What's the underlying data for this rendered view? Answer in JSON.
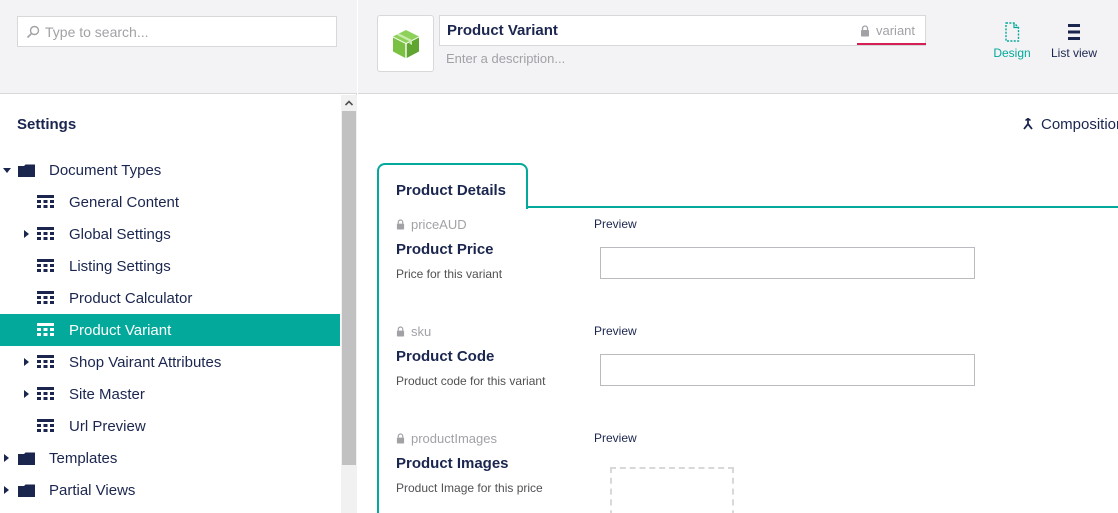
{
  "search": {
    "placeholder": "Type to search..."
  },
  "tree": {
    "title": "Settings",
    "items": [
      {
        "label": "Document Types",
        "kind": "folder",
        "caret": "down"
      },
      {
        "label": "General Content",
        "kind": "doctype",
        "caret": ""
      },
      {
        "label": "Global Settings",
        "kind": "doctype",
        "caret": "right"
      },
      {
        "label": "Listing Settings",
        "kind": "doctype",
        "caret": ""
      },
      {
        "label": "Product Calculator",
        "kind": "doctype",
        "caret": ""
      },
      {
        "label": "Product Variant",
        "kind": "doctype",
        "caret": "",
        "selected": true
      },
      {
        "label": "Shop Vairant Attributes",
        "kind": "doctype",
        "caret": "right"
      },
      {
        "label": "Site Master",
        "kind": "doctype",
        "caret": "right"
      },
      {
        "label": "Url Preview",
        "kind": "doctype",
        "caret": ""
      },
      {
        "label": "Templates",
        "kind": "folder",
        "caret": "right"
      },
      {
        "label": "Partial Views",
        "kind": "folder",
        "caret": "right"
      }
    ]
  },
  "header": {
    "name": "Product Variant",
    "alias": "variant",
    "description_placeholder": "Enter a description...",
    "icon": "box-icon",
    "design_label": "Design",
    "listview_label": "List view"
  },
  "main": {
    "compositions_label": "Compositions",
    "group": {
      "title": "Product Details",
      "properties": [
        {
          "alias": "priceAUD",
          "name": "Product Price",
          "description": "Price for this variant",
          "preview_label": "Preview",
          "editor": "textbox"
        },
        {
          "alias": "sku",
          "name": "Product Code",
          "description": "Product code for this variant",
          "preview_label": "Preview",
          "editor": "textbox"
        },
        {
          "alias": "productImages",
          "name": "Product Images",
          "description": "Product Image for this price",
          "preview_label": "Preview",
          "editor": "media"
        }
      ]
    }
  },
  "colors": {
    "accent": "#03a99b",
    "text": "#1b264f",
    "alias_underline": "#d42054",
    "icon_green": "#7ac143"
  }
}
